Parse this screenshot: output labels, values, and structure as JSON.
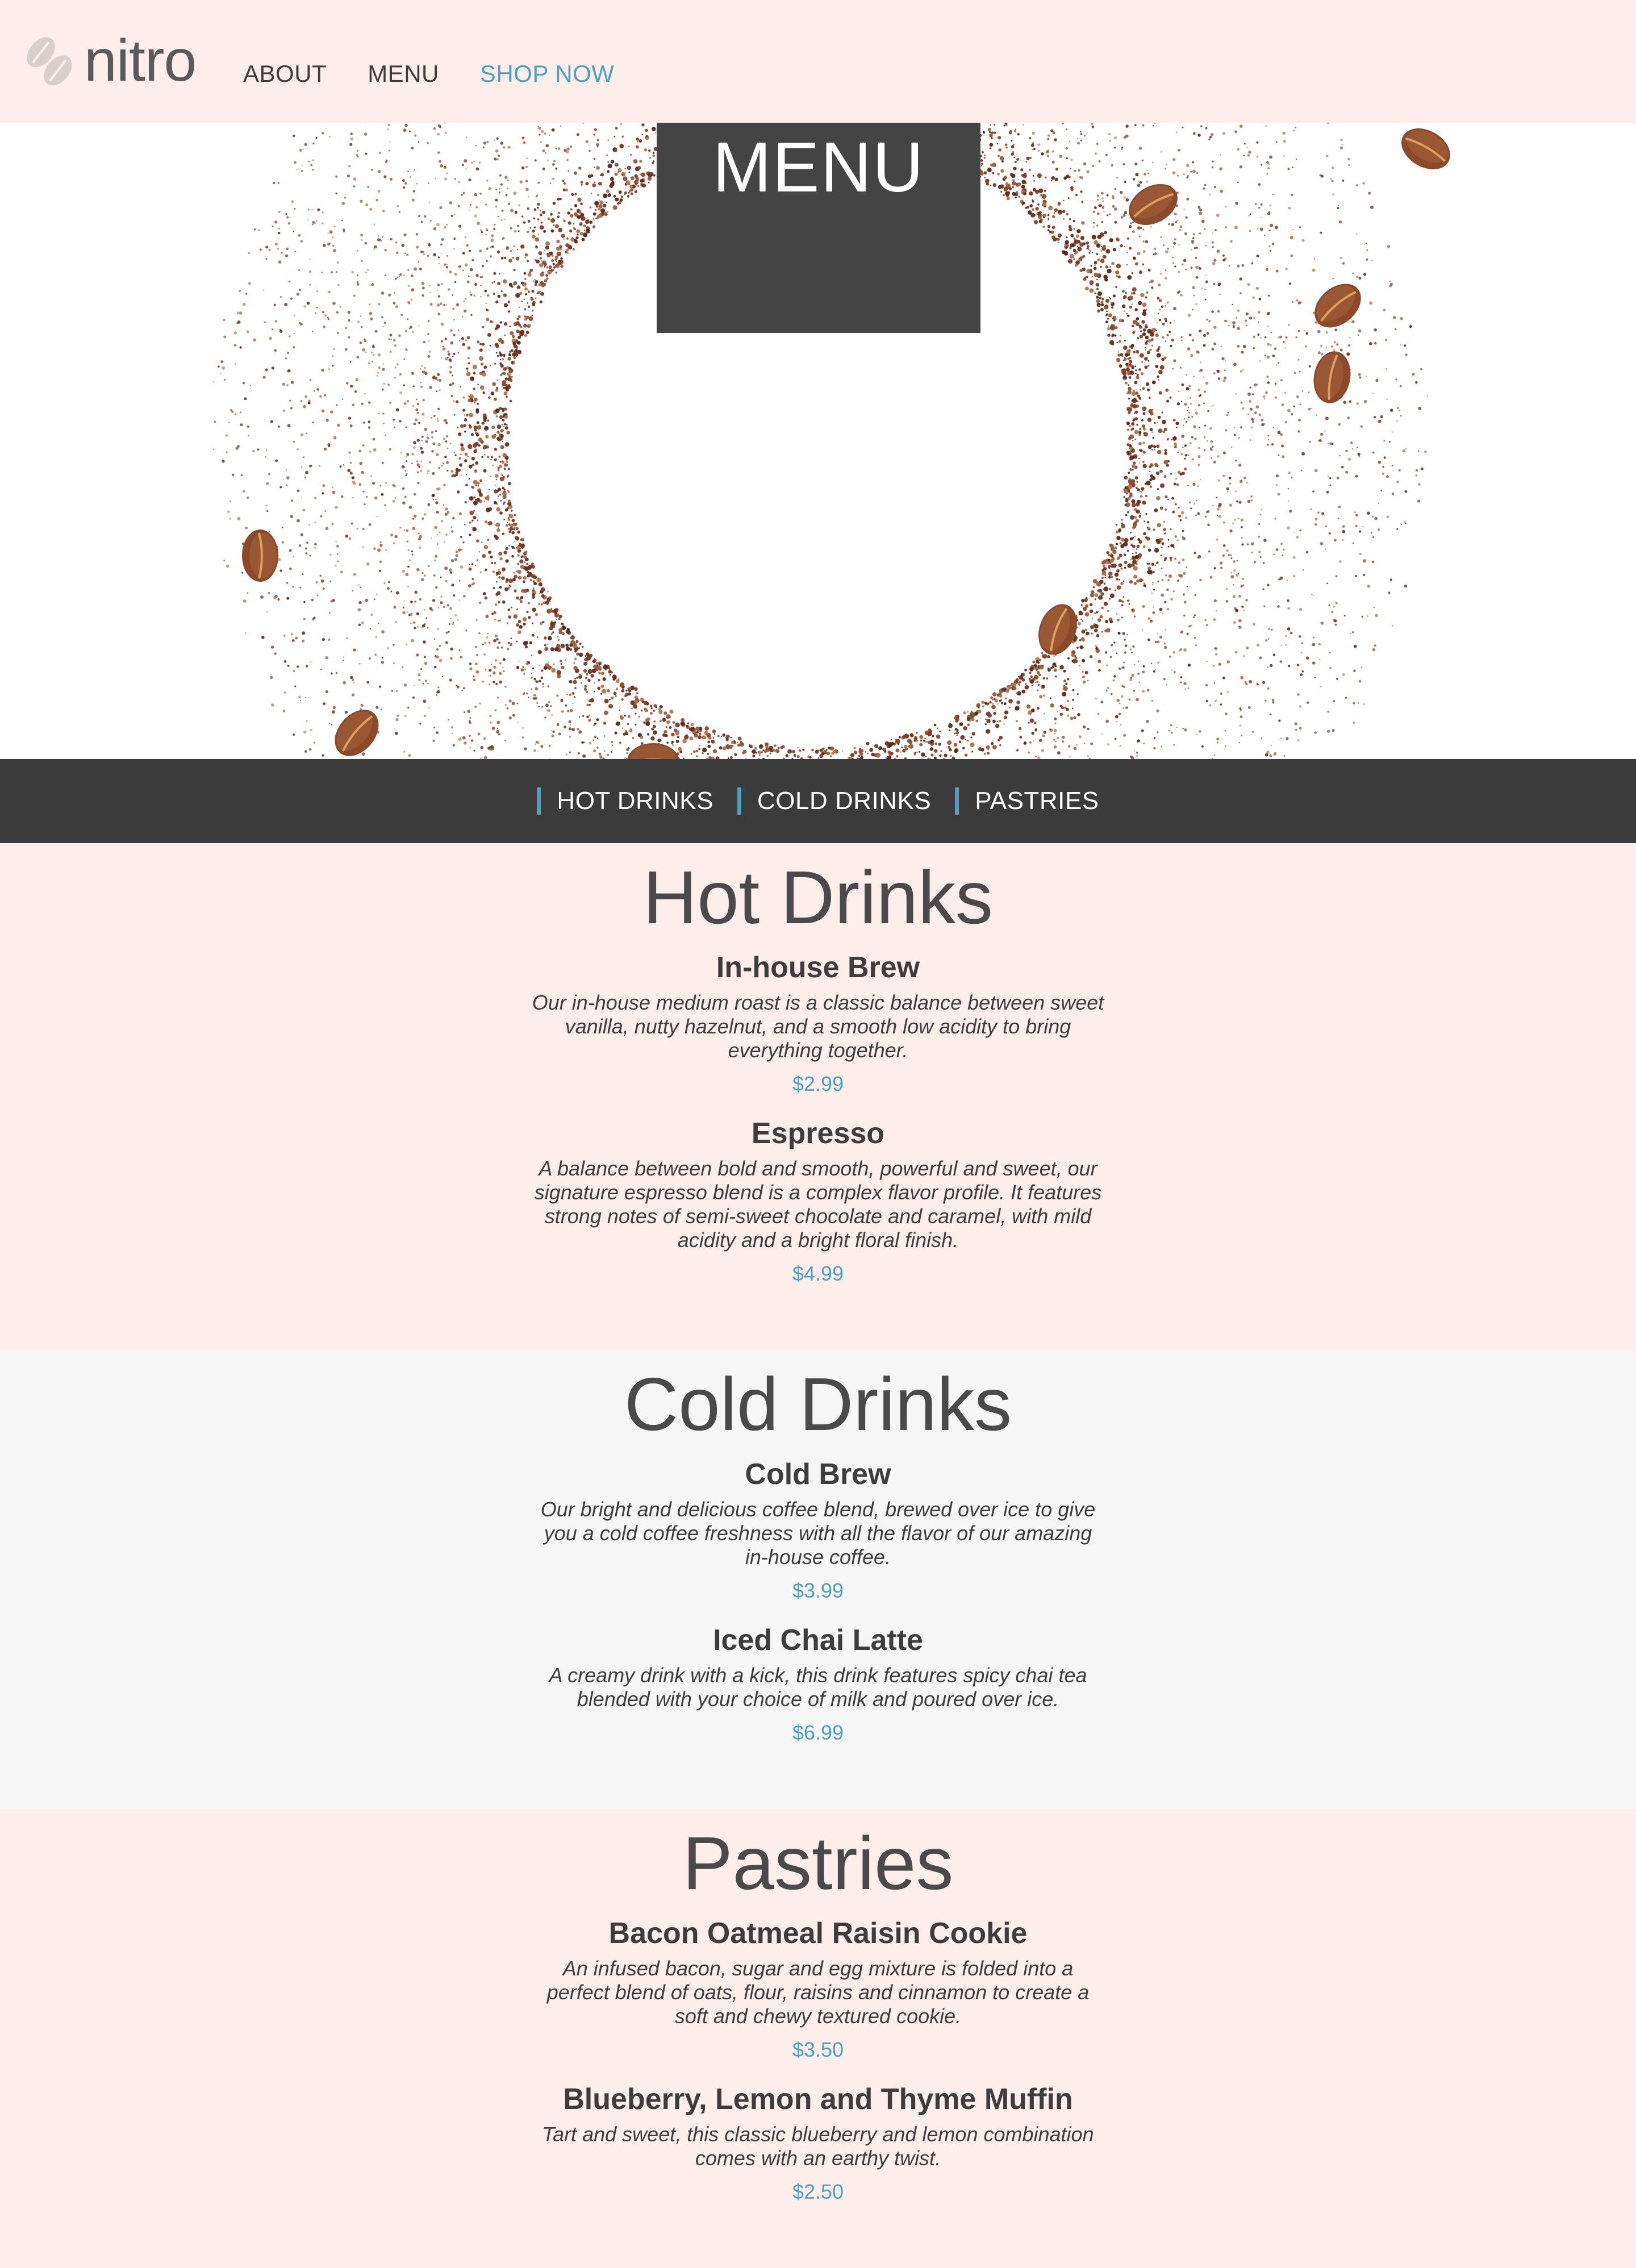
{
  "header": {
    "logo_text": "nitro",
    "logo_icon": "coffee-beans-logo-icon",
    "nav": [
      {
        "label": "ABOUT"
      },
      {
        "label": "MENU"
      },
      {
        "label": "SHOP NOW"
      }
    ]
  },
  "hero": {
    "title": "MENU",
    "image": "coffee-grounds-circle-with-beans"
  },
  "category_bar": {
    "items": [
      {
        "label": "HOT DRINKS"
      },
      {
        "label": "COLD DRINKS"
      },
      {
        "label": "PASTRIES"
      }
    ]
  },
  "sections": {
    "hot": {
      "title": "Hot Drinks",
      "items": [
        {
          "name": "In-house Brew",
          "description": "Our in-house medium roast is a classic balance between sweet vanilla, nutty hazelnut, and a smooth low acidity to bring everything together.",
          "price": "$2.99"
        },
        {
          "name": "Espresso",
          "description": "A balance between bold and smooth, powerful and sweet, our signature espresso blend is a complex flavor profile. It features strong notes of semi-sweet chocolate and caramel, with mild acidity and a bright floral finish.",
          "price": "$4.99"
        }
      ]
    },
    "cold": {
      "title": "Cold Drinks",
      "items": [
        {
          "name": "Cold Brew",
          "description": "Our bright and delicious coffee blend, brewed over ice to give you a cold coffee freshness with all the flavor of our amazing in-house coffee.",
          "price": "$3.99"
        },
        {
          "name": "Iced Chai Latte",
          "description": "A creamy drink with a kick, this drink features spicy chai tea blended with your choice of milk and poured over ice.",
          "price": "$6.99"
        }
      ]
    },
    "pastries": {
      "title": "Pastries",
      "items": [
        {
          "name": "Bacon Oatmeal Raisin Cookie",
          "description": "An infused bacon, sugar and egg mixture is folded into a perfect blend of oats, flour, raisins and cinnamon to create a soft and chewy textured cookie.",
          "price": "$3.50"
        },
        {
          "name": "Blueberry, Lemon and Thyme Muffin",
          "description": "Tart and sweet, this classic blueberry and lemon combination comes with an earthy twist.",
          "price": "$2.50"
        }
      ]
    }
  },
  "colors": {
    "accent": "#4aa3be",
    "page_background": "#fdeeeb",
    "dark_bar": "#3b3b3b",
    "menu_box": "#444444",
    "alt_section": "#f6f6f6"
  }
}
